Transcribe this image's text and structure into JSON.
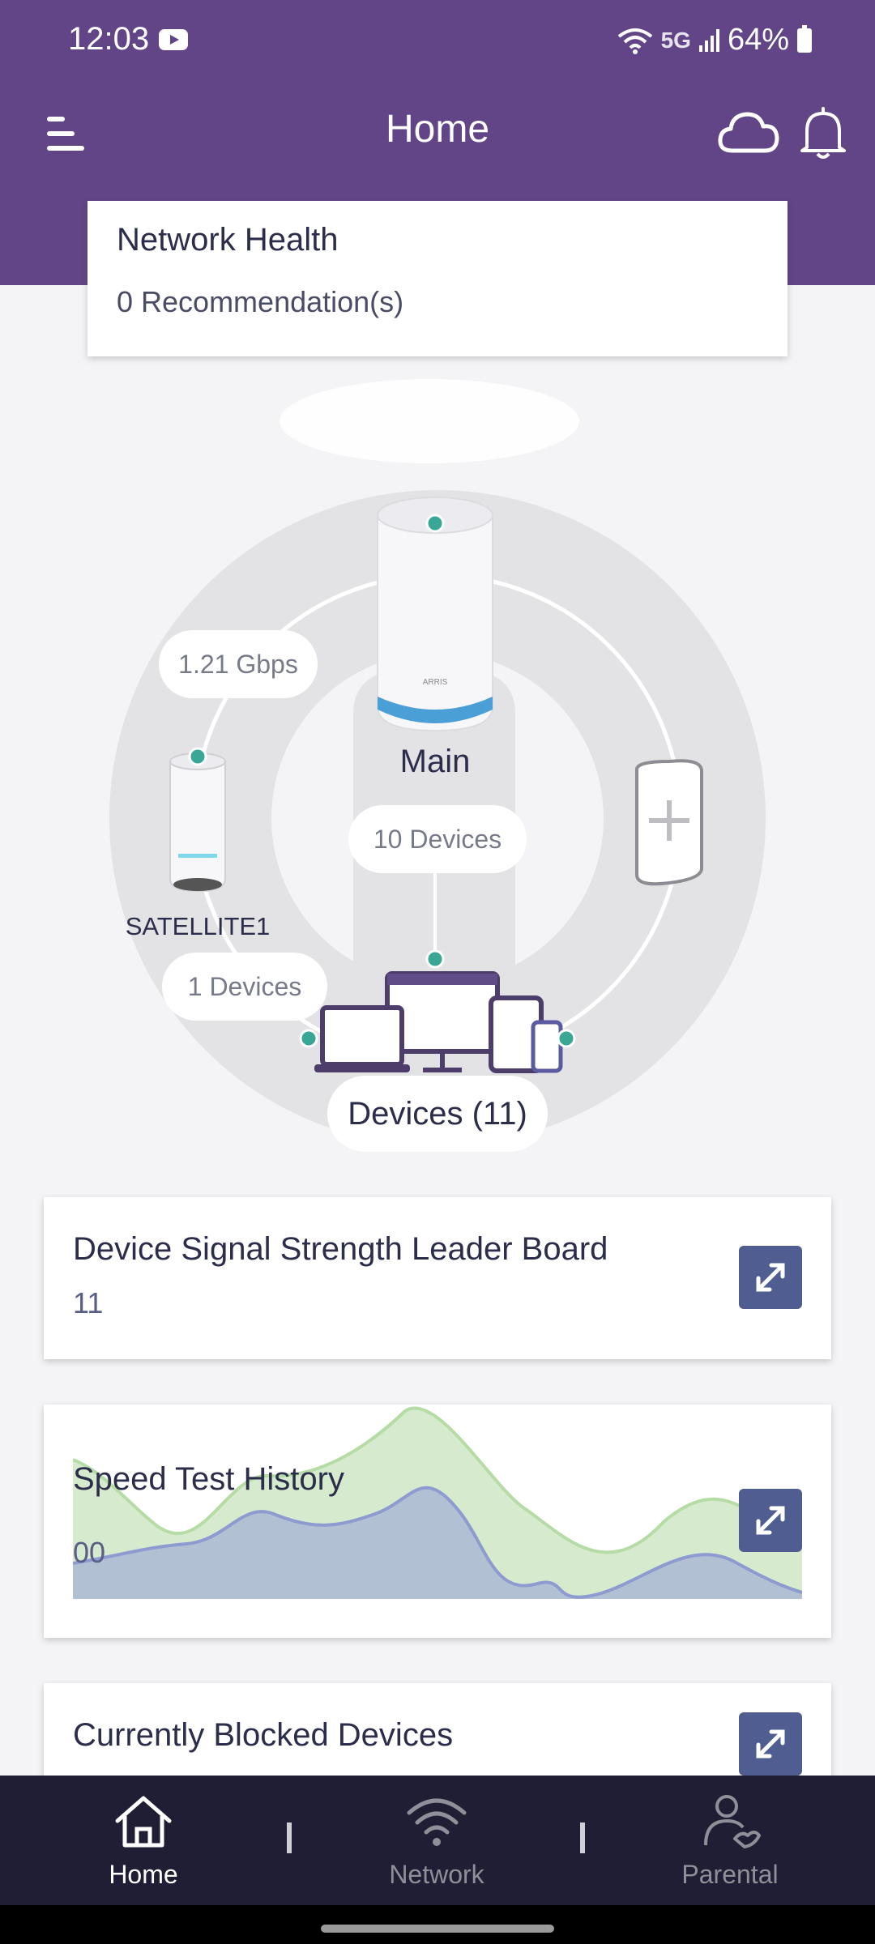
{
  "status_bar": {
    "time": "12:03",
    "network_type": "5G",
    "battery": "64%",
    "notification_icon": "youtube-icon"
  },
  "header": {
    "title": "Home",
    "left_icon": "menu-icon",
    "right_icons": [
      "cloud-icon",
      "bell-icon"
    ]
  },
  "network_health": {
    "title": "Network Health",
    "subtitle": "0 Recommendation(s)"
  },
  "topology": {
    "speed": "1.21 Gbps",
    "main_label": "Main",
    "main_devices": "10 Devices",
    "satellite_label": "SATELLITE1",
    "satellite_devices": "1 Devices",
    "devices_label": "Devices (11)",
    "add_node_icon": "add-satellite-icon"
  },
  "leader_board": {
    "title": "Device Signal Strength Leader Board",
    "value": "11"
  },
  "speed_test": {
    "title": "Speed Test History",
    "value": "00"
  },
  "blocked_devices": {
    "title": "Currently Blocked Devices"
  },
  "bottom_nav": {
    "items": [
      {
        "label": "Home",
        "icon": "home-icon",
        "active": true
      },
      {
        "label": "Network",
        "icon": "wifi-icon",
        "active": false
      },
      {
        "label": "Parental",
        "icon": "parental-icon",
        "active": false
      }
    ]
  },
  "colors": {
    "brand_purple": "#624587",
    "accent_teal": "#3aa796",
    "button_blue": "#4f5d91",
    "nav_background": "#1f1e34"
  }
}
